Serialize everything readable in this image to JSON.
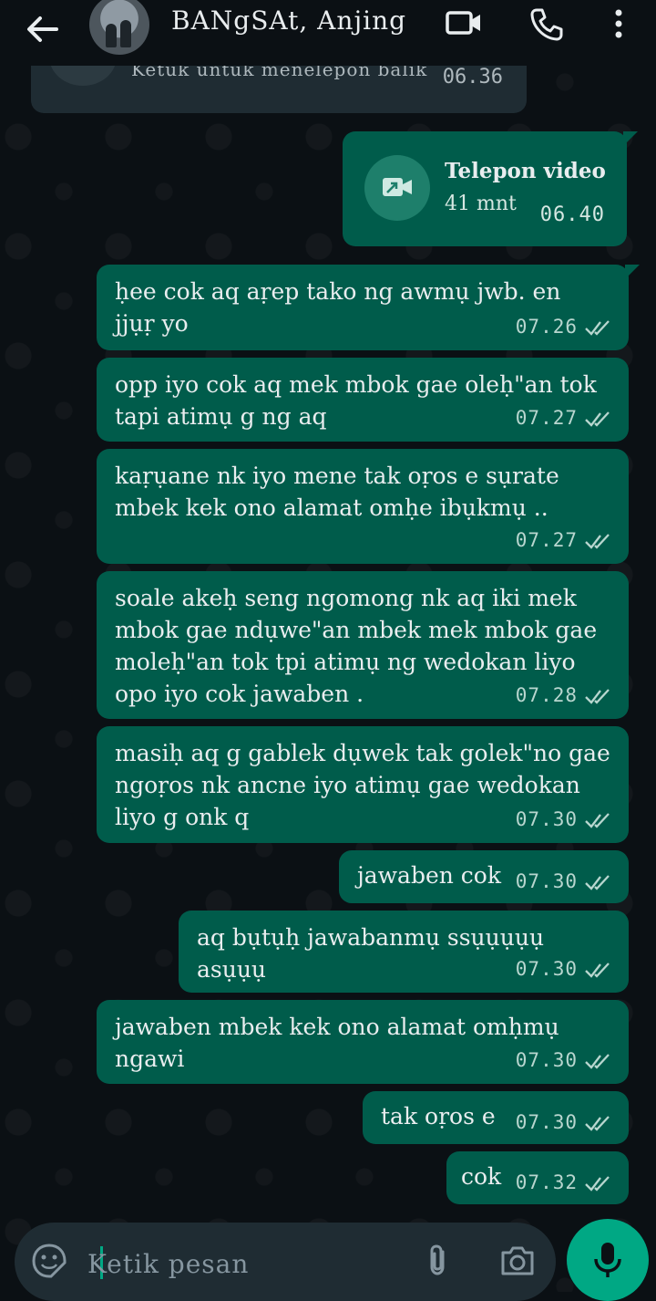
{
  "header": {
    "contact_name": "BANgSAt, Anjing",
    "icons": [
      "back-arrow-icon",
      "avatar",
      "video-call-icon",
      "voice-call-icon",
      "more-options-icon"
    ]
  },
  "previous_call": {
    "label": "Ketuk untuk menelepon balik",
    "time": "06.36"
  },
  "video_call": {
    "title": "Telepon video",
    "duration": "41 mnt",
    "time": "06.40"
  },
  "messages": [
    {
      "text": "ḥee cok aq aṛep tako ng awmụ jwb. en\njjụṛ yo",
      "time": "07.26"
    },
    {
      "text": "opp iyo cok aq mek mbok gae oleḥ\"an tok\ntapi atimụ g ng aq",
      "time": "07.27"
    },
    {
      "text": "kaṛụane nk iyo mene tak oṛos e sụrate\nmbek kek ono alamat omḥe ibụkmụ ..",
      "time": "07.27"
    },
    {
      "text": "soale akeḥ seng ngomong nk aq iki mek\nmbok gae ndụwe\"an mbek mek mbok gae\nmoleḥ\"an tok tpi atimụ ng wedokan liyo\nopo iyo cok jawaben .",
      "time": "07.28"
    },
    {
      "text": "masiḥ aq g gablek dụwek tak golek\"no gae\nngoṛos nk ancne iyo atimụ gae wedokan\nliyo g onk q",
      "time": "07.30"
    },
    {
      "text": "jawaben cok",
      "time": "07.30"
    },
    {
      "text": "aq bụtụḥ jawabanmụ ssụụụụụ asụụụ",
      "time": "07.30"
    },
    {
      "text": "jawaben mbek kek ono alamat omḥmụ\nngawi",
      "time": "07.30"
    },
    {
      "text": "tak oṛos e",
      "time": "07.30"
    },
    {
      "text": "cok",
      "time": "07.32"
    }
  ],
  "composer": {
    "placeholder": "Ketik pesan"
  },
  "colors": {
    "background": "#0b1014",
    "outgoing_bubble": "#005c4b",
    "accent": "#00a884",
    "header": "#0b1014"
  }
}
